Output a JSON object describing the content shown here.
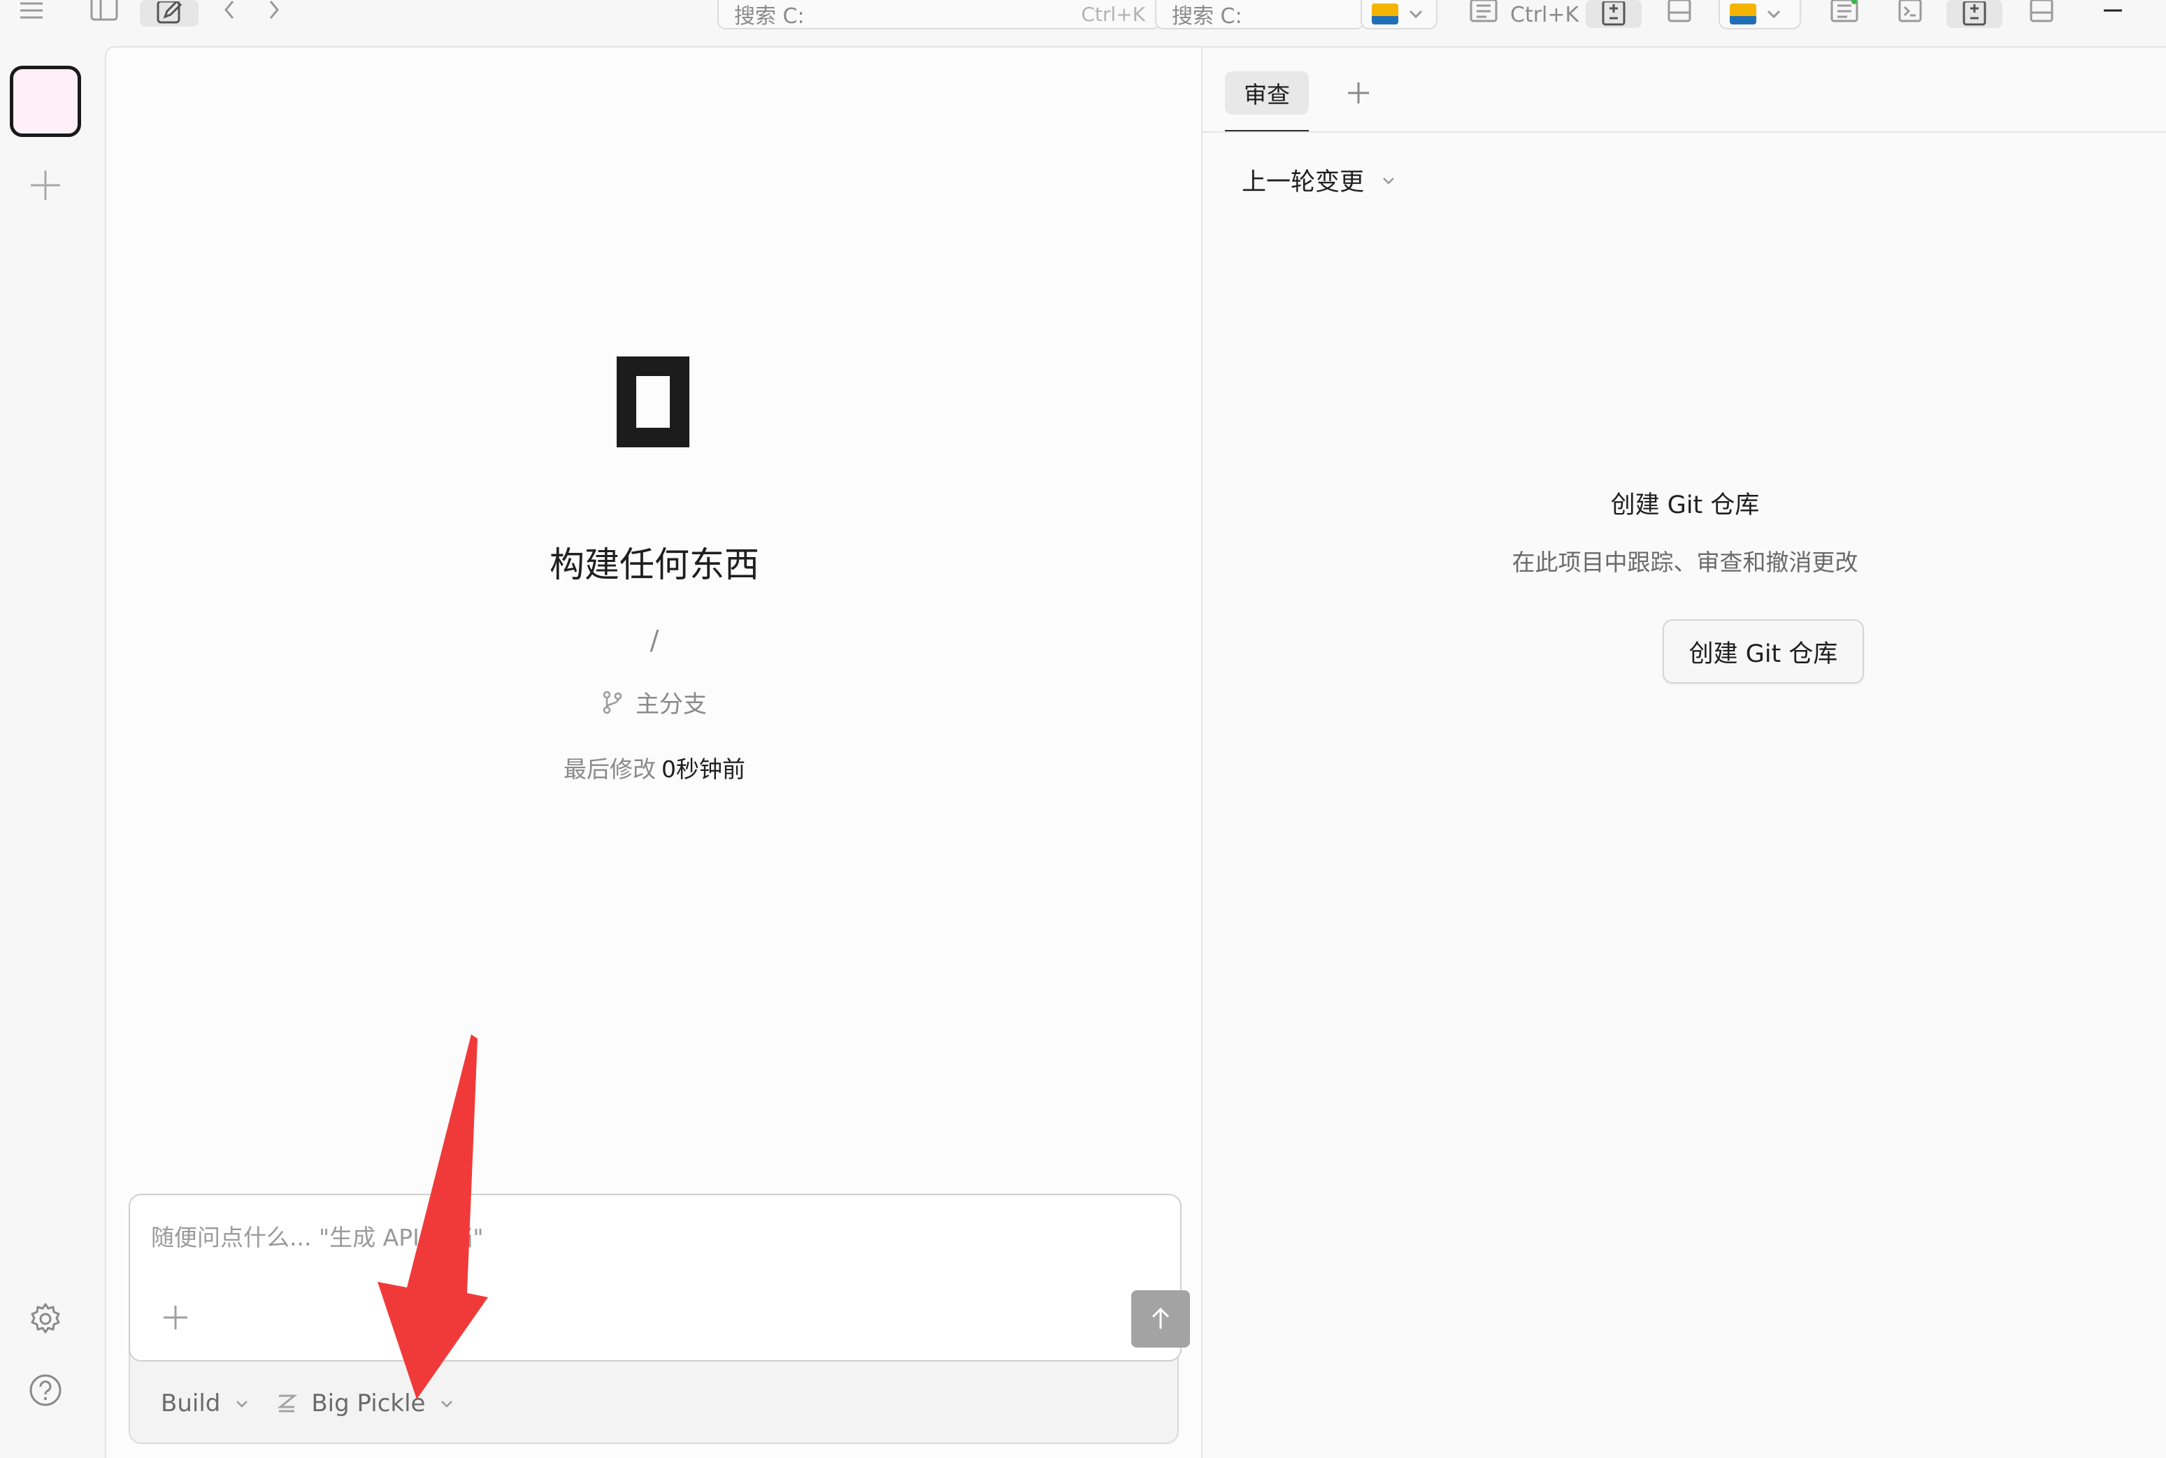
{
  "topbar": {
    "search_1": {
      "placeholder": "搜索 C:",
      "shortcut": "Ctrl+K"
    },
    "search_2": {
      "placeholder": "搜索 C:",
      "shortcut": "Ctrl+K"
    }
  },
  "main": {
    "title": "构建任何东西",
    "path": "/",
    "branch_label": "主分支",
    "modified_label": "最后修改",
    "modified_value": "0秒钟前",
    "composer": {
      "placeholder": "随便问点什么... \"生成 API 文档\"",
      "agent_label": "Build",
      "model_label": "Big Pickle"
    }
  },
  "review": {
    "tab_label": "审查",
    "scope_label": "上一轮变更",
    "git_title": "创建 Git 仓库",
    "git_subtitle": "在此项目中跟踪、审查和撤消更改",
    "git_button": "创建 Git 仓库"
  },
  "colors": {
    "annotation_arrow": "#f03a3a",
    "project_tile": "#fff0f7",
    "folder_yellow": "#f4b400",
    "folder_blue": "#1f6fb8"
  }
}
